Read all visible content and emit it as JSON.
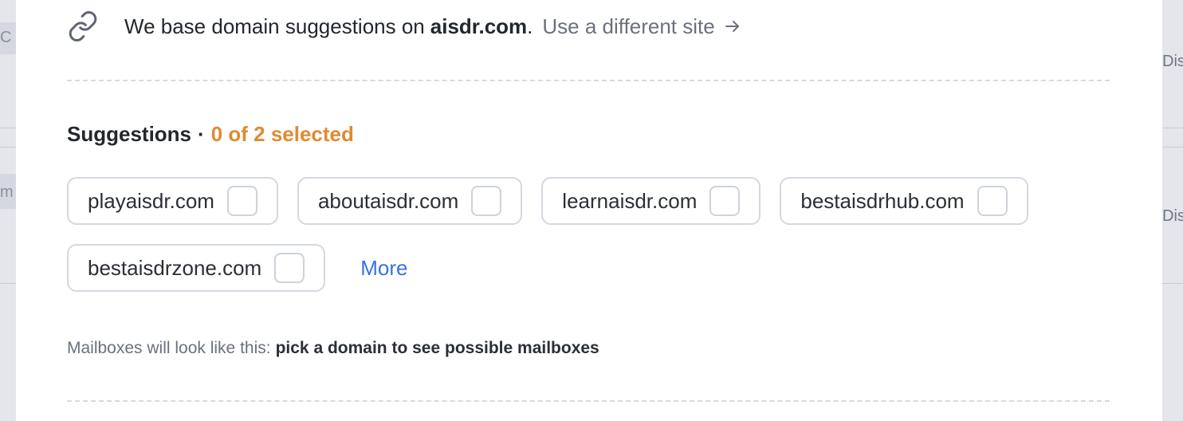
{
  "background": {
    "left_fragments": [
      "C",
      "m"
    ],
    "right_fragments": [
      "Dis",
      "Dis"
    ]
  },
  "site": {
    "icon": "link-icon",
    "prefix": "We base domain suggestions on",
    "domain": "aisdr.com",
    "suffix": ".",
    "change_link": "Use a different site",
    "change_icon": "arrow-right-icon"
  },
  "suggestions": {
    "heading": "Suggestions",
    "separator": "·",
    "selected_status": "0 of 2 selected",
    "accent_color": "#e08a32",
    "items": [
      {
        "domain": "playaisdr.com",
        "checked": false
      },
      {
        "domain": "aboutaisdr.com",
        "checked": false
      },
      {
        "domain": "learnaisdr.com",
        "checked": false
      },
      {
        "domain": "bestaisdrhub.com",
        "checked": false
      },
      {
        "domain": "bestaisdrzone.com",
        "checked": false
      }
    ],
    "more_label": "More",
    "more_color": "#3b6fe0"
  },
  "mailboxes": {
    "label": "Mailboxes will look like this:",
    "hint": "pick a domain to see possible mailboxes"
  }
}
